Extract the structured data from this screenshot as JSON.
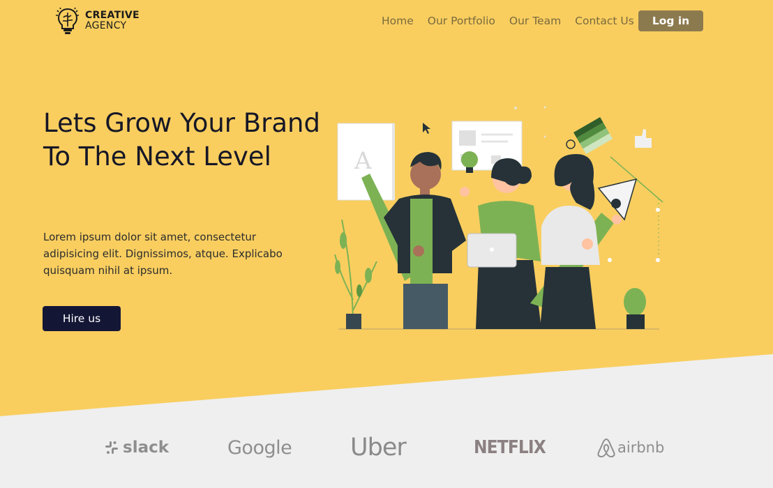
{
  "brand": {
    "line1": "CREATIVE",
    "line2": "AGENCY"
  },
  "nav": {
    "items": [
      {
        "label": "Home"
      },
      {
        "label": "Our Portfolio"
      },
      {
        "label": "Our Team"
      },
      {
        "label": "Contact Us"
      }
    ],
    "login_label": "Log in"
  },
  "hero": {
    "headline": "Lets Grow Your Brand To The Next Level",
    "body": "Lorem ipsum dolor sit amet, consectetur adipisicing elit. Dignissimos, atque. Explicabo quisquam nihil at ipsum.",
    "cta_label": "Hire us",
    "illustration_letter": "A"
  },
  "clients": [
    {
      "name": "slack",
      "icon": "slack-icon"
    },
    {
      "name": "Google",
      "icon": "google-wordmark"
    },
    {
      "name": "Uber",
      "icon": "uber-wordmark"
    },
    {
      "name": "NETFLIX",
      "icon": "netflix-wordmark"
    },
    {
      "name": "airbnb",
      "icon": "airbnb-icon"
    }
  ],
  "colors": {
    "hero_background": "#f9ce5f",
    "page_background": "#efefef",
    "login_button": "#8c7a4f",
    "cta_button": "#141635",
    "nav_link": "#7a6a3e",
    "illustration_green": "#7db254"
  }
}
